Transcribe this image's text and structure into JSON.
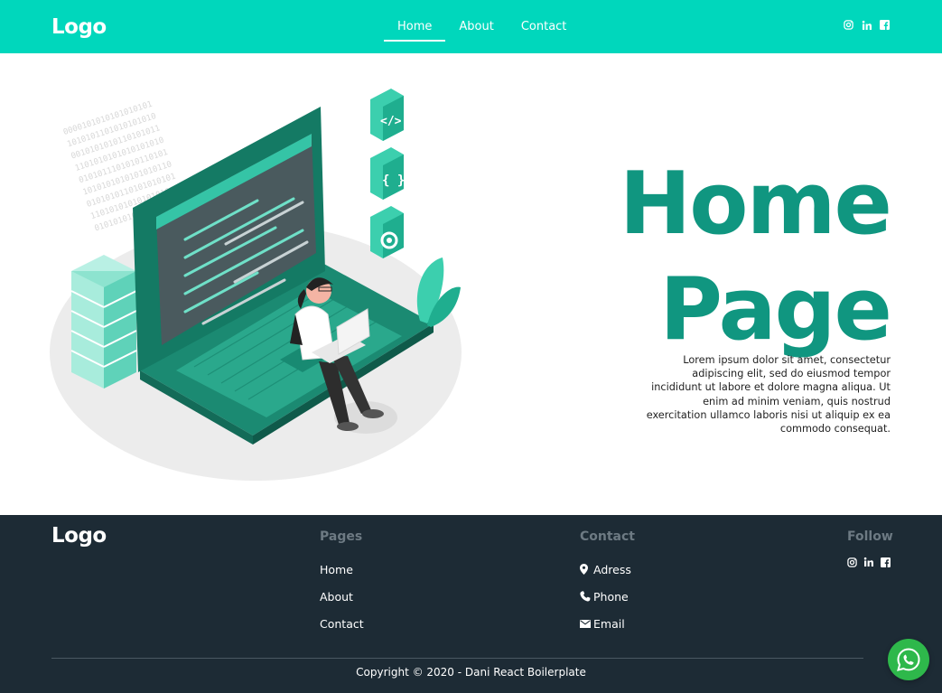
{
  "header": {
    "logo": "Logo",
    "nav": [
      {
        "label": "Home",
        "active": true
      },
      {
        "label": "About",
        "active": false
      },
      {
        "label": "Contact",
        "active": false
      }
    ],
    "social_icons": [
      "instagram-icon",
      "linkedin-icon",
      "facebook-icon"
    ]
  },
  "hero": {
    "title_line1": "Home",
    "title_line2": "Page",
    "description": "Lorem ipsum dolor sit amet, consectetur adipiscing elit, sed do eiusmod tempor incididunt ut labore et dolore magna aliqua. Ut enim ad minim veniam, quis nostrud exercitation ullamco laboris nisi ut aliquip ex ea commodo consequat."
  },
  "footer": {
    "logo": "Logo",
    "pages": {
      "heading": "Pages",
      "links": [
        "Home",
        "About",
        "Contact"
      ]
    },
    "contact": {
      "heading": "Contact",
      "items": [
        {
          "icon": "location-pin-icon",
          "label": "Adress"
        },
        {
          "icon": "phone-icon",
          "label": "Phone"
        },
        {
          "icon": "mail-icon",
          "label": "Email"
        }
      ]
    },
    "follow": {
      "heading": "Follow",
      "icons": [
        "instagram-icon",
        "linkedin-icon",
        "facebook-icon"
      ]
    },
    "copyright": "Copyright © 2020 - Dani React Boilerplate"
  },
  "floating": {
    "icon": "whatsapp-icon"
  },
  "colors": {
    "header_bg": "#00d7bc",
    "accent_title": "#109680",
    "footer_bg": "#1d2b35",
    "whatsapp": "#2eb84b"
  }
}
